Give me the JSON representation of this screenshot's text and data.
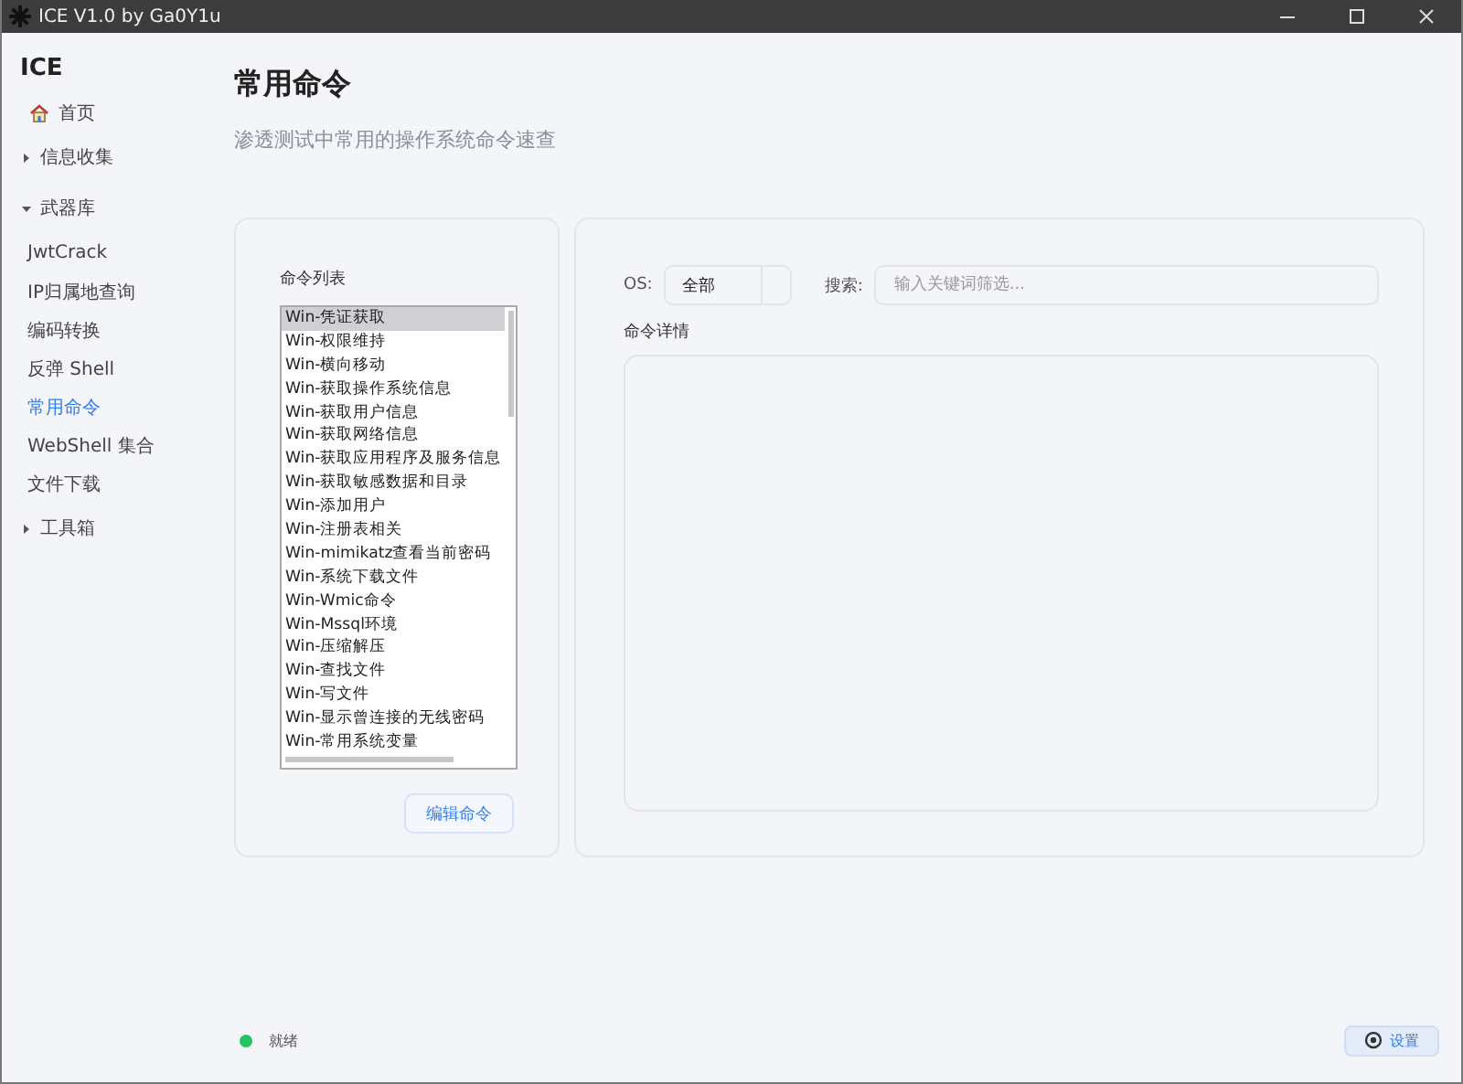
{
  "window": {
    "title": "ICE V1.0 by Ga0Y1u"
  },
  "sidebar": {
    "brand": "ICE",
    "items": [
      {
        "label": "首页",
        "kind": "home",
        "selected": false
      },
      {
        "label": "信息收集",
        "kind": "group",
        "expanded": false,
        "selected": false
      },
      {
        "label": "武器库",
        "kind": "group",
        "expanded": true,
        "selected": false,
        "children": [
          {
            "label": "JwtCrack",
            "selected": false
          },
          {
            "label": "IP归属地查询",
            "selected": false
          },
          {
            "label": "编码转换",
            "selected": false
          },
          {
            "label": "反弹 Shell",
            "selected": false
          },
          {
            "label": "常用命令",
            "selected": true
          },
          {
            "label": "WebShell 集合",
            "selected": false
          },
          {
            "label": "文件下载",
            "selected": false
          }
        ]
      },
      {
        "label": "工具箱",
        "kind": "group",
        "expanded": false,
        "selected": false
      }
    ]
  },
  "page": {
    "title": "常用命令",
    "subtitle": "渗透测试中常用的操作系统命令速查"
  },
  "command_list": {
    "label": "命令列表",
    "items": [
      {
        "label": "Win-凭证获取",
        "selected": true
      },
      {
        "label": "Win-权限维持",
        "selected": false
      },
      {
        "label": "Win-横向移动",
        "selected": false
      },
      {
        "label": "Win-获取操作系统信息",
        "selected": false
      },
      {
        "label": "Win-获取用户信息",
        "selected": false
      },
      {
        "label": "Win-获取网络信息",
        "selected": false
      },
      {
        "label": "Win-获取应用程序及服务信息",
        "selected": false
      },
      {
        "label": "Win-获取敏感数据和目录",
        "selected": false
      },
      {
        "label": "Win-添加用户",
        "selected": false
      },
      {
        "label": "Win-注册表相关",
        "selected": false
      },
      {
        "label": "Win-mimikatz查看当前密码",
        "selected": false
      },
      {
        "label": "Win-系统下载文件",
        "selected": false
      },
      {
        "label": "Win-Wmic命令",
        "selected": false
      },
      {
        "label": "Win-Mssql环境",
        "selected": false
      },
      {
        "label": "Win-压缩解压",
        "selected": false
      },
      {
        "label": "Win-查找文件",
        "selected": false
      },
      {
        "label": "Win-写文件",
        "selected": false
      },
      {
        "label": "Win-显示曾连接的无线密码",
        "selected": false
      },
      {
        "label": "Win-常用系统变量",
        "selected": false
      }
    ],
    "edit_button": "编辑命令"
  },
  "filters": {
    "os_label": "OS:",
    "os_value": "全部",
    "search_label": "搜索:",
    "search_placeholder": "输入关键词筛选..."
  },
  "detail": {
    "label": "命令详情"
  },
  "status_bar": {
    "status": "就绪",
    "settings_button": "设置"
  }
}
